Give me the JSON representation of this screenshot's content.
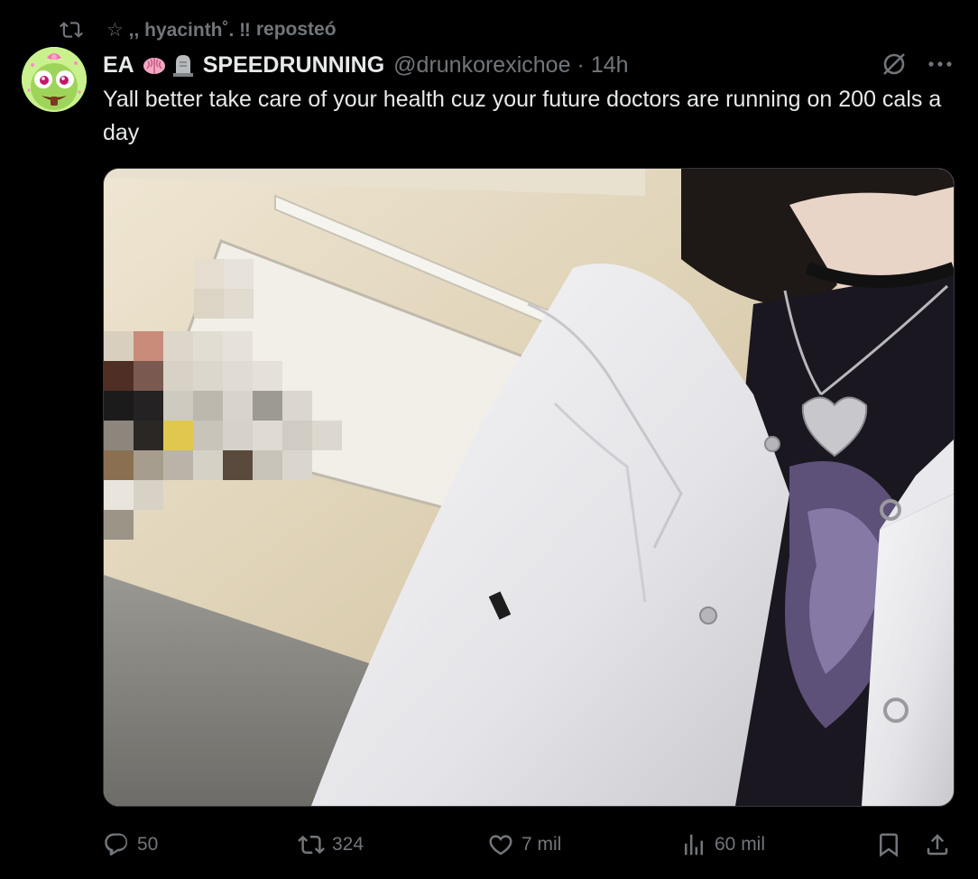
{
  "repost_banner": {
    "reposter": "☆ ,, hyacinth˚. ‼",
    "action": "reposteó"
  },
  "author": {
    "name_prefix": "EA",
    "name_suffix": "SPEEDRUNNING",
    "handle": "@drunkorexichoe",
    "separator": "·",
    "time": "14h",
    "emoji_icons": [
      "brain-icon",
      "headstone-icon"
    ]
  },
  "tweet": {
    "text": "Yall better take care of your health cuz your future doctors are running on 200 cals a day"
  },
  "actions": {
    "replies": "50",
    "reposts": "324",
    "likes": "7 mil",
    "views": "60 mil"
  },
  "colors": {
    "background": "#000000",
    "text_primary": "#e7e9ea",
    "text_secondary": "#71767b",
    "border": "#333639"
  }
}
